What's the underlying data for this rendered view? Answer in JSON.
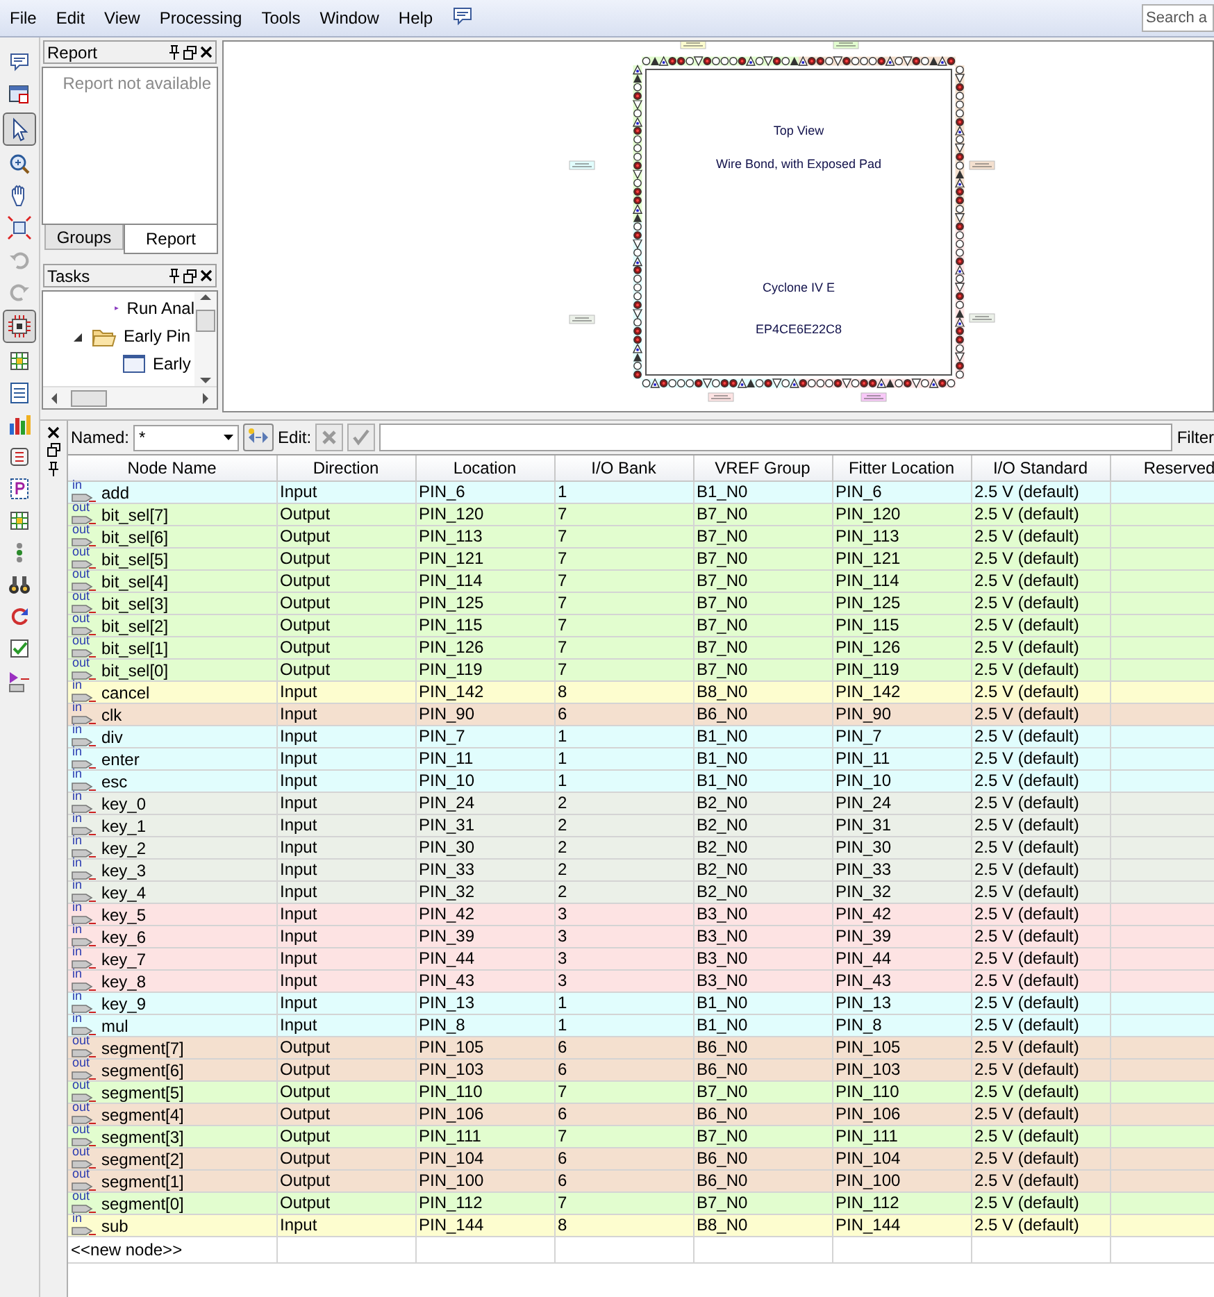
{
  "menu": [
    "File",
    "Edit",
    "View",
    "Processing",
    "Tools",
    "Window",
    "Help"
  ],
  "search": {
    "placeholder": "Search a"
  },
  "left_toolbar": [
    {
      "kind": "comment",
      "selected": false
    },
    {
      "kind": "window",
      "selected": false
    },
    {
      "kind": "pointer",
      "selected": true
    },
    {
      "kind": "zoom",
      "selected": false
    },
    {
      "kind": "hand",
      "selected": false
    },
    {
      "kind": "fit",
      "selected": false
    },
    {
      "kind": "undo",
      "selected": false
    },
    {
      "kind": "redo",
      "selected": false
    },
    {
      "kind": "chip",
      "selected": true
    },
    {
      "kind": "grid",
      "selected": false
    },
    {
      "kind": "list",
      "selected": false
    },
    {
      "kind": "bars",
      "selected": false
    },
    {
      "kind": "switch",
      "selected": false
    },
    {
      "kind": "pin",
      "selected": false
    },
    {
      "kind": "grid",
      "selected": false
    },
    {
      "kind": "dots",
      "selected": false
    },
    {
      "kind": "binoculars",
      "selected": false
    },
    {
      "kind": "refresh",
      "selected": false
    },
    {
      "kind": "check",
      "selected": false
    },
    {
      "kind": "io",
      "selected": false
    }
  ],
  "report_panel": {
    "title": "Report",
    "message": "Report not available"
  },
  "panel_tabs": [
    {
      "label": "Groups",
      "selected": false
    },
    {
      "label": "Report",
      "selected": true
    }
  ],
  "tasks_panel": {
    "title": "Tasks",
    "items": [
      {
        "label": "Run Anal",
        "kind": "run"
      },
      {
        "label": "Early Pin",
        "kind": "folder",
        "expanded": true,
        "children": [
          {
            "label": "Early",
            "kind": "window"
          }
        ]
      }
    ]
  },
  "package_view": {
    "lines": [
      "Top View",
      "Wire Bond, with Exposed Pad",
      "Cyclone IV E",
      "EP4CE6E22C8"
    ]
  },
  "filter_bar": {
    "named_label": "Named:",
    "named_value": "*",
    "edit_label": "Edit:",
    "filter_label": "Filter"
  },
  "table": {
    "columns": [
      "Node Name",
      "Direction",
      "Location",
      "I/O Bank",
      "VREF Group",
      "Fitter Location",
      "I/O Standard",
      "Reserved"
    ],
    "rows": [
      {
        "icon": "in",
        "name": "add",
        "direction": "Input",
        "location": "PIN_6",
        "bank": "1",
        "vref": "B1_N0",
        "fitter": "PIN_6",
        "standard": "2.5 V (default)",
        "color": "#e1fdfd"
      },
      {
        "icon": "out",
        "name": "bit_sel[7]",
        "direction": "Output",
        "location": "PIN_120",
        "bank": "7",
        "vref": "B7_N0",
        "fitter": "PIN_120",
        "standard": "2.5 V (default)",
        "color": "#e2fdcf"
      },
      {
        "icon": "out",
        "name": "bit_sel[6]",
        "direction": "Output",
        "location": "PIN_113",
        "bank": "7",
        "vref": "B7_N0",
        "fitter": "PIN_113",
        "standard": "2.5 V (default)",
        "color": "#e2fdcf"
      },
      {
        "icon": "out",
        "name": "bit_sel[5]",
        "direction": "Output",
        "location": "PIN_121",
        "bank": "7",
        "vref": "B7_N0",
        "fitter": "PIN_121",
        "standard": "2.5 V (default)",
        "color": "#e2fdcf"
      },
      {
        "icon": "out",
        "name": "bit_sel[4]",
        "direction": "Output",
        "location": "PIN_114",
        "bank": "7",
        "vref": "B7_N0",
        "fitter": "PIN_114",
        "standard": "2.5 V (default)",
        "color": "#e2fdcf"
      },
      {
        "icon": "out",
        "name": "bit_sel[3]",
        "direction": "Output",
        "location": "PIN_125",
        "bank": "7",
        "vref": "B7_N0",
        "fitter": "PIN_125",
        "standard": "2.5 V (default)",
        "color": "#e2fdcf"
      },
      {
        "icon": "out",
        "name": "bit_sel[2]",
        "direction": "Output",
        "location": "PIN_115",
        "bank": "7",
        "vref": "B7_N0",
        "fitter": "PIN_115",
        "standard": "2.5 V (default)",
        "color": "#e2fdcf"
      },
      {
        "icon": "out",
        "name": "bit_sel[1]",
        "direction": "Output",
        "location": "PIN_126",
        "bank": "7",
        "vref": "B7_N0",
        "fitter": "PIN_126",
        "standard": "2.5 V (default)",
        "color": "#e2fdcf"
      },
      {
        "icon": "out",
        "name": "bit_sel[0]",
        "direction": "Output",
        "location": "PIN_119",
        "bank": "7",
        "vref": "B7_N0",
        "fitter": "PIN_119",
        "standard": "2.5 V (default)",
        "color": "#e2fdcf"
      },
      {
        "icon": "in",
        "name": "cancel",
        "direction": "Input",
        "location": "PIN_142",
        "bank": "8",
        "vref": "B8_N0",
        "fitter": "PIN_142",
        "standard": "2.5 V (default)",
        "color": "#fdfdcf"
      },
      {
        "icon": "in",
        "name": "clk",
        "direction": "Input",
        "location": "PIN_90",
        "bank": "6",
        "vref": "B6_N0",
        "fitter": "PIN_90",
        "standard": "2.5 V (default)",
        "color": "#f4e0cf"
      },
      {
        "icon": "in",
        "name": "div",
        "direction": "Input",
        "location": "PIN_7",
        "bank": "1",
        "vref": "B1_N0",
        "fitter": "PIN_7",
        "standard": "2.5 V (default)",
        "color": "#e1fdfd"
      },
      {
        "icon": "in",
        "name": "enter",
        "direction": "Input",
        "location": "PIN_11",
        "bank": "1",
        "vref": "B1_N0",
        "fitter": "PIN_11",
        "standard": "2.5 V (default)",
        "color": "#e1fdfd"
      },
      {
        "icon": "in",
        "name": "esc",
        "direction": "Input",
        "location": "PIN_10",
        "bank": "1",
        "vref": "B1_N0",
        "fitter": "PIN_10",
        "standard": "2.5 V (default)",
        "color": "#e1fdfd"
      },
      {
        "icon": "in",
        "name": "key_0",
        "direction": "Input",
        "location": "PIN_24",
        "bank": "2",
        "vref": "B2_N0",
        "fitter": "PIN_24",
        "standard": "2.5 V (default)",
        "color": "#ebf0e8"
      },
      {
        "icon": "in",
        "name": "key_1",
        "direction": "Input",
        "location": "PIN_31",
        "bank": "2",
        "vref": "B2_N0",
        "fitter": "PIN_31",
        "standard": "2.5 V (default)",
        "color": "#ebf0e8"
      },
      {
        "icon": "in",
        "name": "key_2",
        "direction": "Input",
        "location": "PIN_30",
        "bank": "2",
        "vref": "B2_N0",
        "fitter": "PIN_30",
        "standard": "2.5 V (default)",
        "color": "#ebf0e8"
      },
      {
        "icon": "in",
        "name": "key_3",
        "direction": "Input",
        "location": "PIN_33",
        "bank": "2",
        "vref": "B2_N0",
        "fitter": "PIN_33",
        "standard": "2.5 V (default)",
        "color": "#ebf0e8"
      },
      {
        "icon": "in",
        "name": "key_4",
        "direction": "Input",
        "location": "PIN_32",
        "bank": "2",
        "vref": "B2_N0",
        "fitter": "PIN_32",
        "standard": "2.5 V (default)",
        "color": "#ebf0e8"
      },
      {
        "icon": "in",
        "name": "key_5",
        "direction": "Input",
        "location": "PIN_42",
        "bank": "3",
        "vref": "B3_N0",
        "fitter": "PIN_42",
        "standard": "2.5 V (default)",
        "color": "#fde3e3"
      },
      {
        "icon": "in",
        "name": "key_6",
        "direction": "Input",
        "location": "PIN_39",
        "bank": "3",
        "vref": "B3_N0",
        "fitter": "PIN_39",
        "standard": "2.5 V (default)",
        "color": "#fde3e3"
      },
      {
        "icon": "in",
        "name": "key_7",
        "direction": "Input",
        "location": "PIN_44",
        "bank": "3",
        "vref": "B3_N0",
        "fitter": "PIN_44",
        "standard": "2.5 V (default)",
        "color": "#fde3e3"
      },
      {
        "icon": "in",
        "name": "key_8",
        "direction": "Input",
        "location": "PIN_43",
        "bank": "3",
        "vref": "B3_N0",
        "fitter": "PIN_43",
        "standard": "2.5 V (default)",
        "color": "#fde3e3"
      },
      {
        "icon": "in",
        "name": "key_9",
        "direction": "Input",
        "location": "PIN_13",
        "bank": "1",
        "vref": "B1_N0",
        "fitter": "PIN_13",
        "standard": "2.5 V (default)",
        "color": "#e1fdfd"
      },
      {
        "icon": "in",
        "name": "mul",
        "direction": "Input",
        "location": "PIN_8",
        "bank": "1",
        "vref": "B1_N0",
        "fitter": "PIN_8",
        "standard": "2.5 V (default)",
        "color": "#e1fdfd"
      },
      {
        "icon": "out",
        "name": "segment[7]",
        "direction": "Output",
        "location": "PIN_105",
        "bank": "6",
        "vref": "B6_N0",
        "fitter": "PIN_105",
        "standard": "2.5 V (default)",
        "color": "#f4e0cf"
      },
      {
        "icon": "out",
        "name": "segment[6]",
        "direction": "Output",
        "location": "PIN_103",
        "bank": "6",
        "vref": "B6_N0",
        "fitter": "PIN_103",
        "standard": "2.5 V (default)",
        "color": "#f4e0cf"
      },
      {
        "icon": "out",
        "name": "segment[5]",
        "direction": "Output",
        "location": "PIN_110",
        "bank": "7",
        "vref": "B7_N0",
        "fitter": "PIN_110",
        "standard": "2.5 V (default)",
        "color": "#e2fdcf"
      },
      {
        "icon": "out",
        "name": "segment[4]",
        "direction": "Output",
        "location": "PIN_106",
        "bank": "6",
        "vref": "B6_N0",
        "fitter": "PIN_106",
        "standard": "2.5 V (default)",
        "color": "#f4e0cf"
      },
      {
        "icon": "out",
        "name": "segment[3]",
        "direction": "Output",
        "location": "PIN_111",
        "bank": "7",
        "vref": "B7_N0",
        "fitter": "PIN_111",
        "standard": "2.5 V (default)",
        "color": "#e2fdcf"
      },
      {
        "icon": "out",
        "name": "segment[2]",
        "direction": "Output",
        "location": "PIN_104",
        "bank": "6",
        "vref": "B6_N0",
        "fitter": "PIN_104",
        "standard": "2.5 V (default)",
        "color": "#f4e0cf"
      },
      {
        "icon": "out",
        "name": "segment[1]",
        "direction": "Output",
        "location": "PIN_100",
        "bank": "6",
        "vref": "B6_N0",
        "fitter": "PIN_100",
        "standard": "2.5 V (default)",
        "color": "#f4e0cf"
      },
      {
        "icon": "out",
        "name": "segment[0]",
        "direction": "Output",
        "location": "PIN_112",
        "bank": "7",
        "vref": "B7_N0",
        "fitter": "PIN_112",
        "standard": "2.5 V (default)",
        "color": "#e2fdcf"
      },
      {
        "icon": "in",
        "name": "sub",
        "direction": "Input",
        "location": "PIN_144",
        "bank": "8",
        "vref": "B8_N0",
        "fitter": "PIN_144",
        "standard": "2.5 V (default)",
        "color": "#fdfdcf"
      }
    ],
    "new_row": "<<new node>>"
  }
}
